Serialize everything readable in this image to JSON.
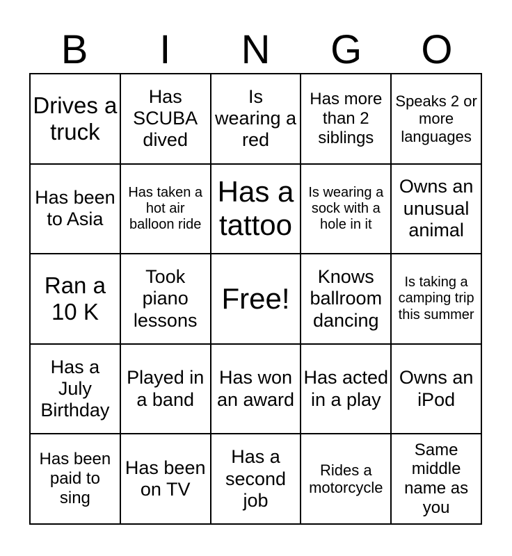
{
  "card": {
    "title": "BINGO",
    "header_letters": [
      "B",
      "I",
      "N",
      "G",
      "O"
    ],
    "free_space_label": "Free!",
    "colors": {
      "background": "#ffffff",
      "text": "#000000",
      "grid_line": "#000000"
    },
    "grid": {
      "columns": 5,
      "rows": 5,
      "cells": [
        {
          "text": "Drives a truck",
          "size": "lg"
        },
        {
          "text": "Has SCUBA dived",
          "size": "md"
        },
        {
          "text": "Is wearing a red",
          "size": "md"
        },
        {
          "text": "Has more than 2 siblings",
          "size": "sm"
        },
        {
          "text": "Speaks 2 or more languages",
          "size": "xs"
        },
        {
          "text": "Has been to Asia",
          "size": "md"
        },
        {
          "text": "Has taken a hot air balloon ride",
          "size": "xxs"
        },
        {
          "text": "Has a tattoo",
          "size": "xl"
        },
        {
          "text": "Is wearing a sock with a hole in it",
          "size": "xxs"
        },
        {
          "text": "Owns an unusual animal",
          "size": "md"
        },
        {
          "text": "Ran a 10 K",
          "size": "lg"
        },
        {
          "text": "Took piano lessons",
          "size": "md"
        },
        {
          "text": "Free!",
          "size": "xl"
        },
        {
          "text": "Knows ballroom dancing",
          "size": "md"
        },
        {
          "text": "Is taking a camping trip this summer",
          "size": "xxs"
        },
        {
          "text": "Has a July Birthday",
          "size": "md"
        },
        {
          "text": "Played in a band",
          "size": "md"
        },
        {
          "text": "Has won an award",
          "size": "md"
        },
        {
          "text": "Has acted in a play",
          "size": "md"
        },
        {
          "text": "Owns an iPod",
          "size": "md"
        },
        {
          "text": "Has been paid to sing",
          "size": "sm"
        },
        {
          "text": "Has been on TV",
          "size": "md"
        },
        {
          "text": "Has a second job",
          "size": "md"
        },
        {
          "text": "Rides a motorcycle",
          "size": "xs"
        },
        {
          "text": "Same middle name as you",
          "size": "sm"
        }
      ]
    }
  }
}
